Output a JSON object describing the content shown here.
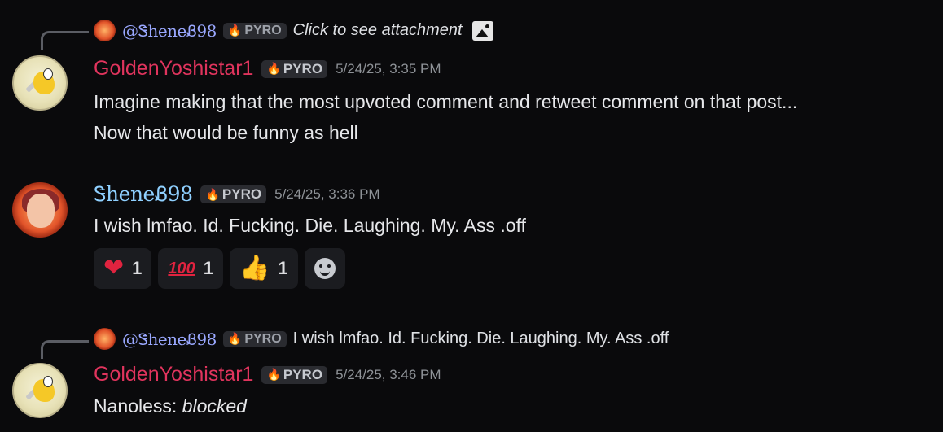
{
  "messages": [
    {
      "reply": {
        "mention": "@ᏕheneᏰ98",
        "tag": "PYRO",
        "preview": "Click to see attachment",
        "preview_icon": "image-icon"
      },
      "author": "GoldenYoshistar1",
      "tag": "PYRO",
      "timestamp": "5/24/25, 3:35 PM",
      "lines": [
        "Imagine making that the most upvoted comment and retweet comment on that post...",
        "Now that would be funny as hell"
      ]
    },
    {
      "author": "ᏕheneᏰ98",
      "tag": "PYRO",
      "timestamp": "5/24/25, 3:36 PM",
      "lines": [
        "I wish lmfao. Id. Fucking. Die. Laughing. My. Ass .off"
      ],
      "reactions": [
        {
          "emoji": "heart",
          "count": "1"
        },
        {
          "emoji": "hundred",
          "label": "100",
          "count": "1"
        },
        {
          "emoji": "thumbs-up",
          "count": "1"
        }
      ]
    },
    {
      "reply": {
        "mention": "@ᏕheneᏰ98",
        "tag": "PYRO",
        "preview": "I wish lmfao. Id. Fucking. Die. Laughing. My. Ass .off"
      },
      "author": "GoldenYoshistar1",
      "tag": "PYRO",
      "timestamp": "5/24/25, 3:46 PM",
      "content_prefix": "Nanoless: ",
      "content_emphasis": "blocked"
    }
  ],
  "colors": {
    "background": "#0a0a0c",
    "golden_name": "#e0345d",
    "shene_name": "#8fd0ff",
    "tag_bg": "#2a2b30"
  }
}
